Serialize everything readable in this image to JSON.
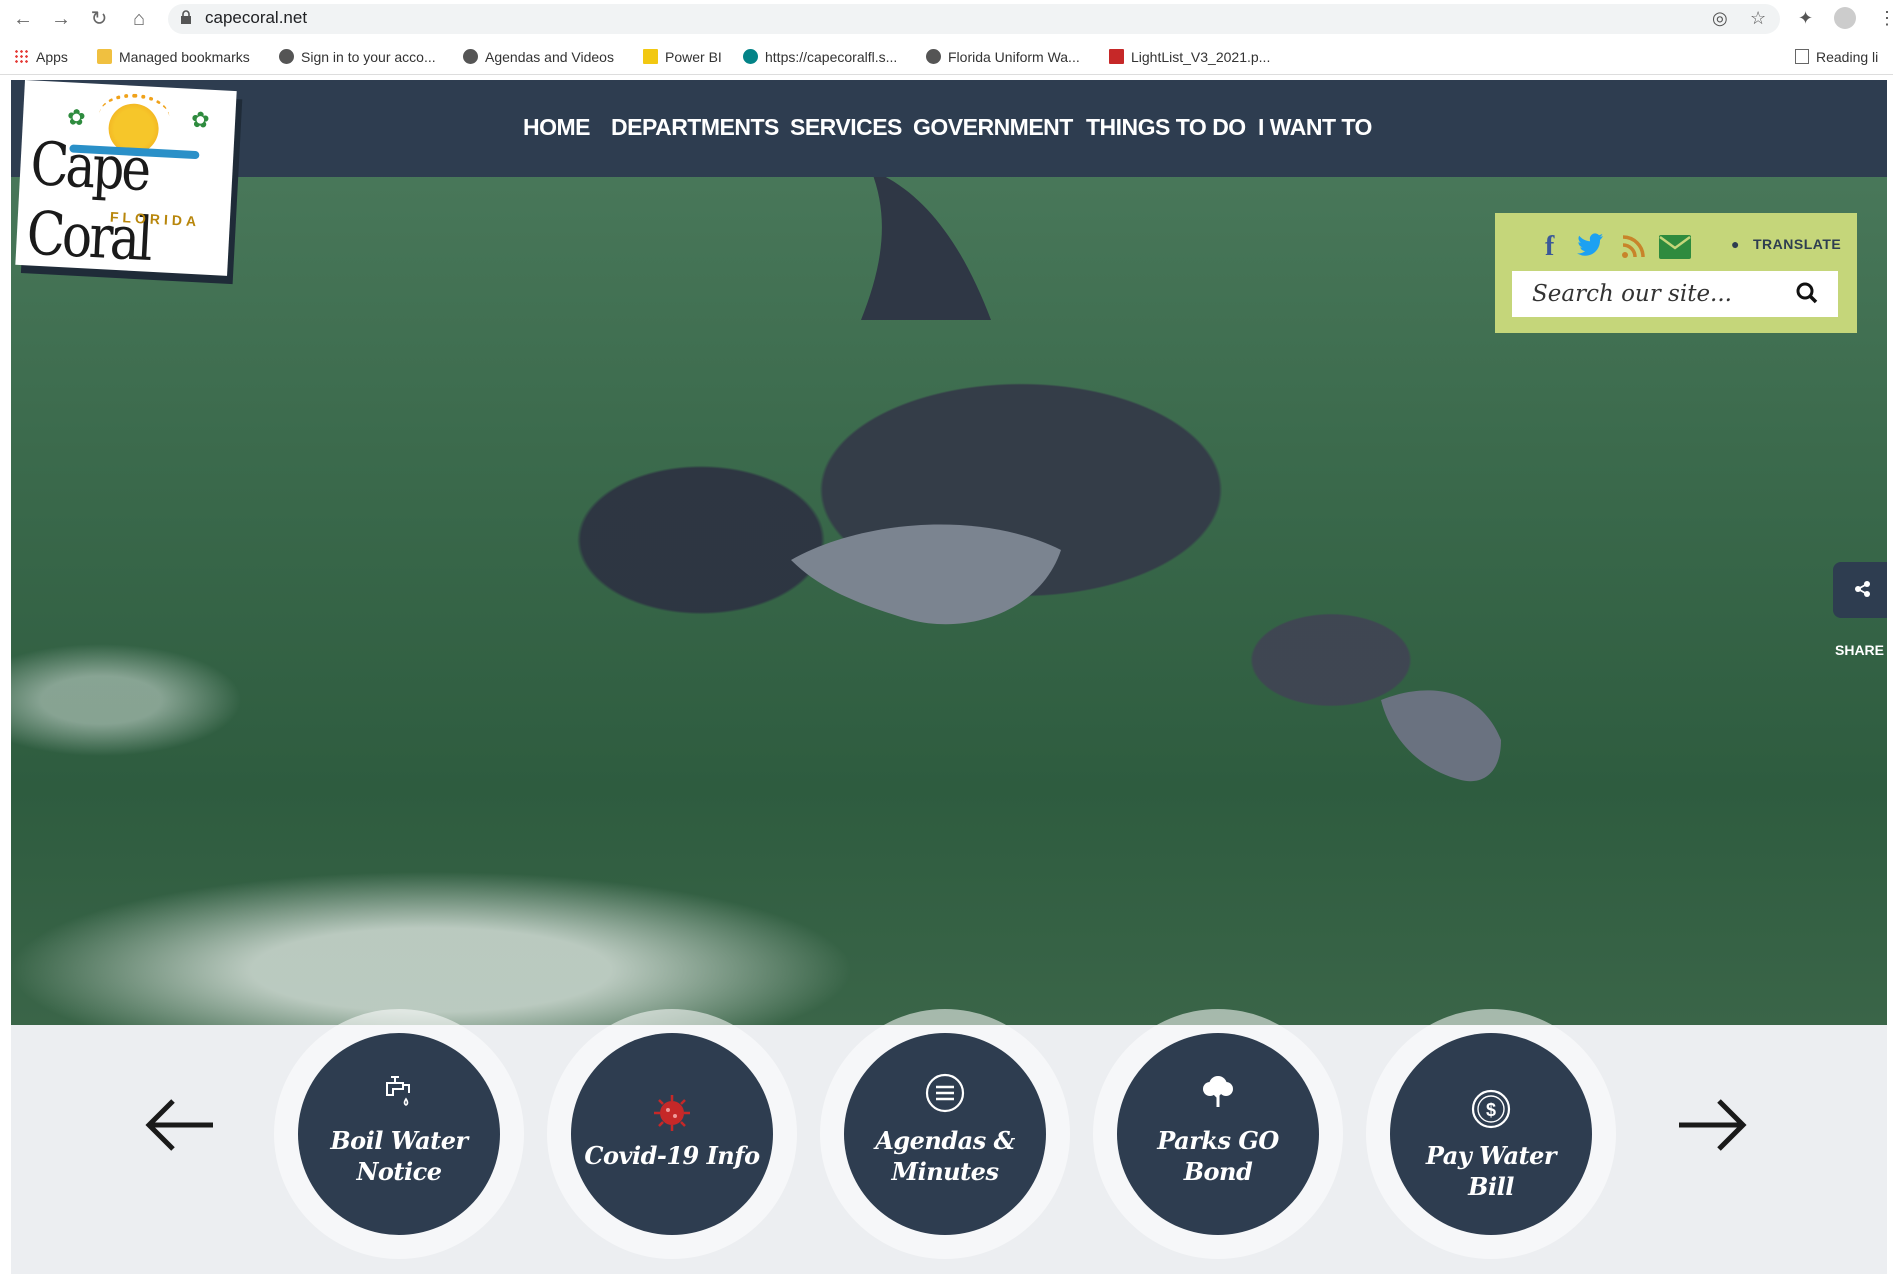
{
  "browser": {
    "url": "capecoral.net",
    "bookmarks": [
      {
        "label": "Apps",
        "icon": "apps-grid-icon"
      },
      {
        "label": "Managed bookmarks",
        "icon": "folder-icon"
      },
      {
        "label": "Sign in to your acco...",
        "icon": "globe-icon"
      },
      {
        "label": "Agendas and Videos",
        "icon": "globe-icon"
      },
      {
        "label": "Power BI",
        "icon": "powerbi-icon"
      },
      {
        "label": "https://capecoralfl.s...",
        "icon": "sharepoint-icon"
      },
      {
        "label": "Florida Uniform Wa...",
        "icon": "globe-icon"
      },
      {
        "label": "LightList_V3_2021.p...",
        "icon": "pdf-icon"
      },
      {
        "label": "Reading li",
        "icon": "reading-list-icon"
      }
    ]
  },
  "site": {
    "logo_text": "Cape Coral",
    "logo_subtext": "FLORIDA",
    "nav": [
      "HOME",
      "DEPARTMENTS",
      "SERVICES",
      "GOVERNMENT",
      "THINGS TO DO",
      "I WANT TO"
    ],
    "translate": "TRANSLATE",
    "search_placeholder": "Search our site...",
    "share_label": "SHARE"
  },
  "quick_links": [
    {
      "line1": "Boil Water",
      "line2": "Notice",
      "icon": "faucet-icon"
    },
    {
      "line1": "Covid-19 Info",
      "line2": "",
      "icon": "virus-icon"
    },
    {
      "line1": "Agendas &",
      "line2": "Minutes",
      "icon": "list-icon"
    },
    {
      "line1": "Parks GO",
      "line2": "Bond",
      "icon": "tree-icon"
    },
    {
      "line1": "Pay Water Bill",
      "line2": "",
      "icon": "dollar-icon"
    }
  ],
  "colors": {
    "nav_bg": "#2e3d50",
    "utility_box": "#c5d67a",
    "quick_bg": "#eceef1",
    "facebook": "#3b5998",
    "twitter": "#1da1f2",
    "rss": "#c8842a",
    "email": "#2e8b3e"
  }
}
